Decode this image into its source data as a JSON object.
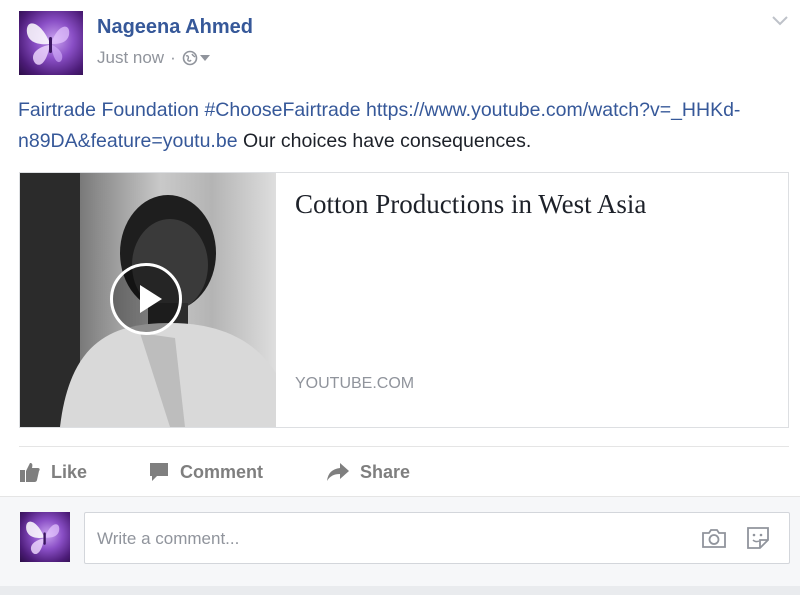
{
  "post": {
    "author": "Nageena Ahmed",
    "timestamp": "Just now",
    "separator": "·",
    "privacy_icon": "globe-icon",
    "text_links": [
      "Fairtrade Foundation",
      "#ChooseFairtrade",
      "https://www.youtube.com/watch?v=_HHKd-n89DA&feature=youtu.be"
    ],
    "text_plain": "Our choices have consequences."
  },
  "link_card": {
    "title": "Cotton Productions in West Asia",
    "domain": "YOUTUBE.COM",
    "play_icon": "play-icon"
  },
  "actions": {
    "like": "Like",
    "comment": "Comment",
    "share": "Share"
  },
  "comment_box": {
    "placeholder": "Write a comment..."
  },
  "colors": {
    "link": "#365899",
    "text": "#1d2129",
    "muted": "#90949c",
    "action": "#7f7f7f",
    "comment_bg": "#f6f7f9"
  }
}
